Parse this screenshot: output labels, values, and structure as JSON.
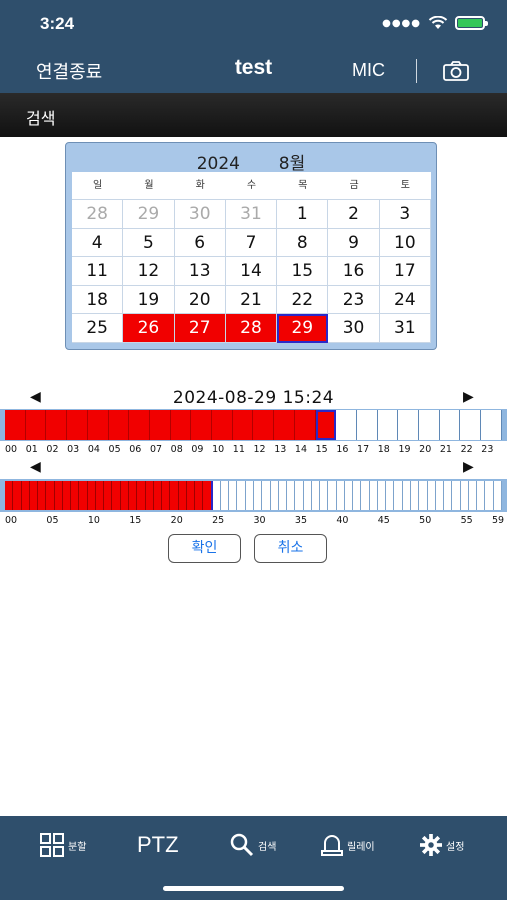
{
  "status": {
    "time": "3:24"
  },
  "nav": {
    "left": "연결종료",
    "title": "test",
    "mic": "MIC"
  },
  "subbar": {
    "title": "검색"
  },
  "calendar": {
    "year": "2024",
    "month": "8월",
    "weekdays": [
      "일",
      "월",
      "화",
      "수",
      "목",
      "금",
      "토"
    ],
    "days": [
      {
        "d": "28",
        "kind": "other"
      },
      {
        "d": "29",
        "kind": "other"
      },
      {
        "d": "30",
        "kind": "other"
      },
      {
        "d": "31",
        "kind": "other"
      },
      {
        "d": "1",
        "kind": ""
      },
      {
        "d": "2",
        "kind": ""
      },
      {
        "d": "3",
        "kind": ""
      },
      {
        "d": "4",
        "kind": ""
      },
      {
        "d": "5",
        "kind": ""
      },
      {
        "d": "6",
        "kind": ""
      },
      {
        "d": "7",
        "kind": ""
      },
      {
        "d": "8",
        "kind": ""
      },
      {
        "d": "9",
        "kind": ""
      },
      {
        "d": "10",
        "kind": ""
      },
      {
        "d": "11",
        "kind": ""
      },
      {
        "d": "12",
        "kind": ""
      },
      {
        "d": "13",
        "kind": ""
      },
      {
        "d": "14",
        "kind": ""
      },
      {
        "d": "15",
        "kind": ""
      },
      {
        "d": "16",
        "kind": ""
      },
      {
        "d": "17",
        "kind": ""
      },
      {
        "d": "18",
        "kind": ""
      },
      {
        "d": "19",
        "kind": ""
      },
      {
        "d": "20",
        "kind": ""
      },
      {
        "d": "21",
        "kind": ""
      },
      {
        "d": "22",
        "kind": ""
      },
      {
        "d": "23",
        "kind": ""
      },
      {
        "d": "24",
        "kind": ""
      },
      {
        "d": "25",
        "kind": ""
      },
      {
        "d": "26",
        "kind": "rec"
      },
      {
        "d": "27",
        "kind": "rec"
      },
      {
        "d": "28",
        "kind": "rec"
      },
      {
        "d": "29",
        "kind": "sel"
      },
      {
        "d": "30",
        "kind": ""
      },
      {
        "d": "31",
        "kind": ""
      }
    ]
  },
  "timeline": {
    "datetime": "2024-08-29 15:24",
    "prev_arrow": "◀",
    "next_arrow": "▶",
    "hours": [
      "00",
      "01",
      "02",
      "03",
      "04",
      "05",
      "06",
      "07",
      "08",
      "09",
      "10",
      "11",
      "12",
      "13",
      "14",
      "15",
      "16",
      "17",
      "18",
      "19",
      "20",
      "21",
      "22",
      "23"
    ],
    "hours_recorded_through": 15,
    "current_hour": 15,
    "minute_labels": [
      "00",
      "05",
      "10",
      "15",
      "20",
      "25",
      "30",
      "35",
      "40",
      "45",
      "50",
      "55",
      "59"
    ],
    "minutes_recorded_through": 24,
    "current_minute": 24
  },
  "buttons": {
    "confirm": "확인",
    "cancel": "취소"
  },
  "tabbar": {
    "split": "분할",
    "ptz": "PTZ",
    "search": "검색",
    "relay": "릴레이",
    "settings": "설정"
  },
  "colors": {
    "nav_bg": "#2f4f6c",
    "record_red": "#f10000",
    "select_blue": "#2a28c8",
    "calendar_bg": "#a9c7e8"
  }
}
